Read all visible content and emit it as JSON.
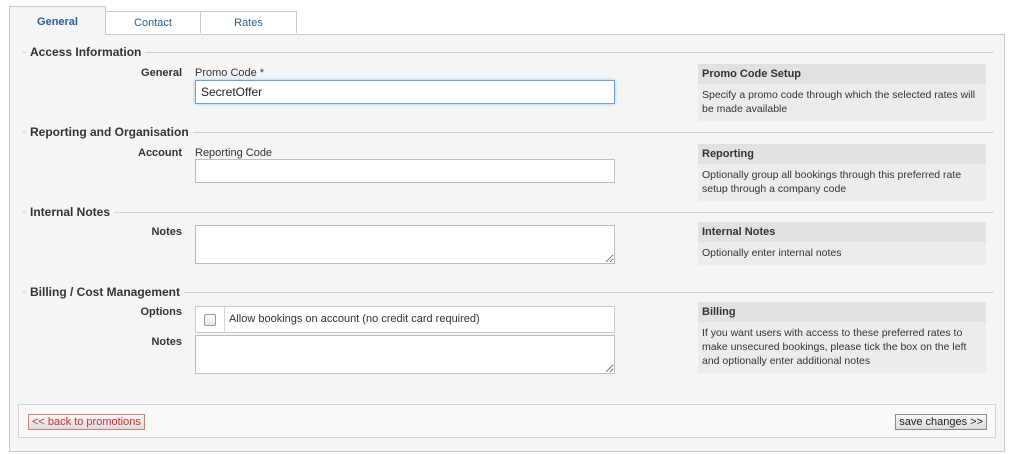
{
  "tabs": [
    {
      "label": "General",
      "active": true
    },
    {
      "label": "Contact",
      "active": false
    },
    {
      "label": "Rates",
      "active": false
    }
  ],
  "sections": {
    "access": {
      "title": "Access Information",
      "row_label": "General",
      "field_label": "Promo Code *",
      "value": "SecretOffer",
      "help_title": "Promo Code Setup",
      "help_text": "Specify a promo code through which the selected rates will be made available"
    },
    "reporting": {
      "title": "Reporting and Organisation",
      "row_label": "Account",
      "field_label": "Reporting Code",
      "value": "",
      "help_title": "Reporting",
      "help_text": "Optionally group all bookings through this preferred rate setup through a company code"
    },
    "internal": {
      "title": "Internal Notes",
      "row_label": "Notes",
      "value": "",
      "help_title": "Internal Notes",
      "help_text": "Optionally enter internal notes"
    },
    "billing": {
      "title": "Billing / Cost Management",
      "options_label": "Options",
      "checkbox_label": "Allow bookings on account (no credit card required)",
      "checked": false,
      "notes_label": "Notes",
      "notes_value": "",
      "help_title": "Billing",
      "help_text": "If you want users with access to these preferred rates to make unsecured bookings, please tick the box on the left and optionally enter additional notes"
    }
  },
  "footer": {
    "back_label": "<< back to promotions",
    "save_label": "save changes >>"
  }
}
